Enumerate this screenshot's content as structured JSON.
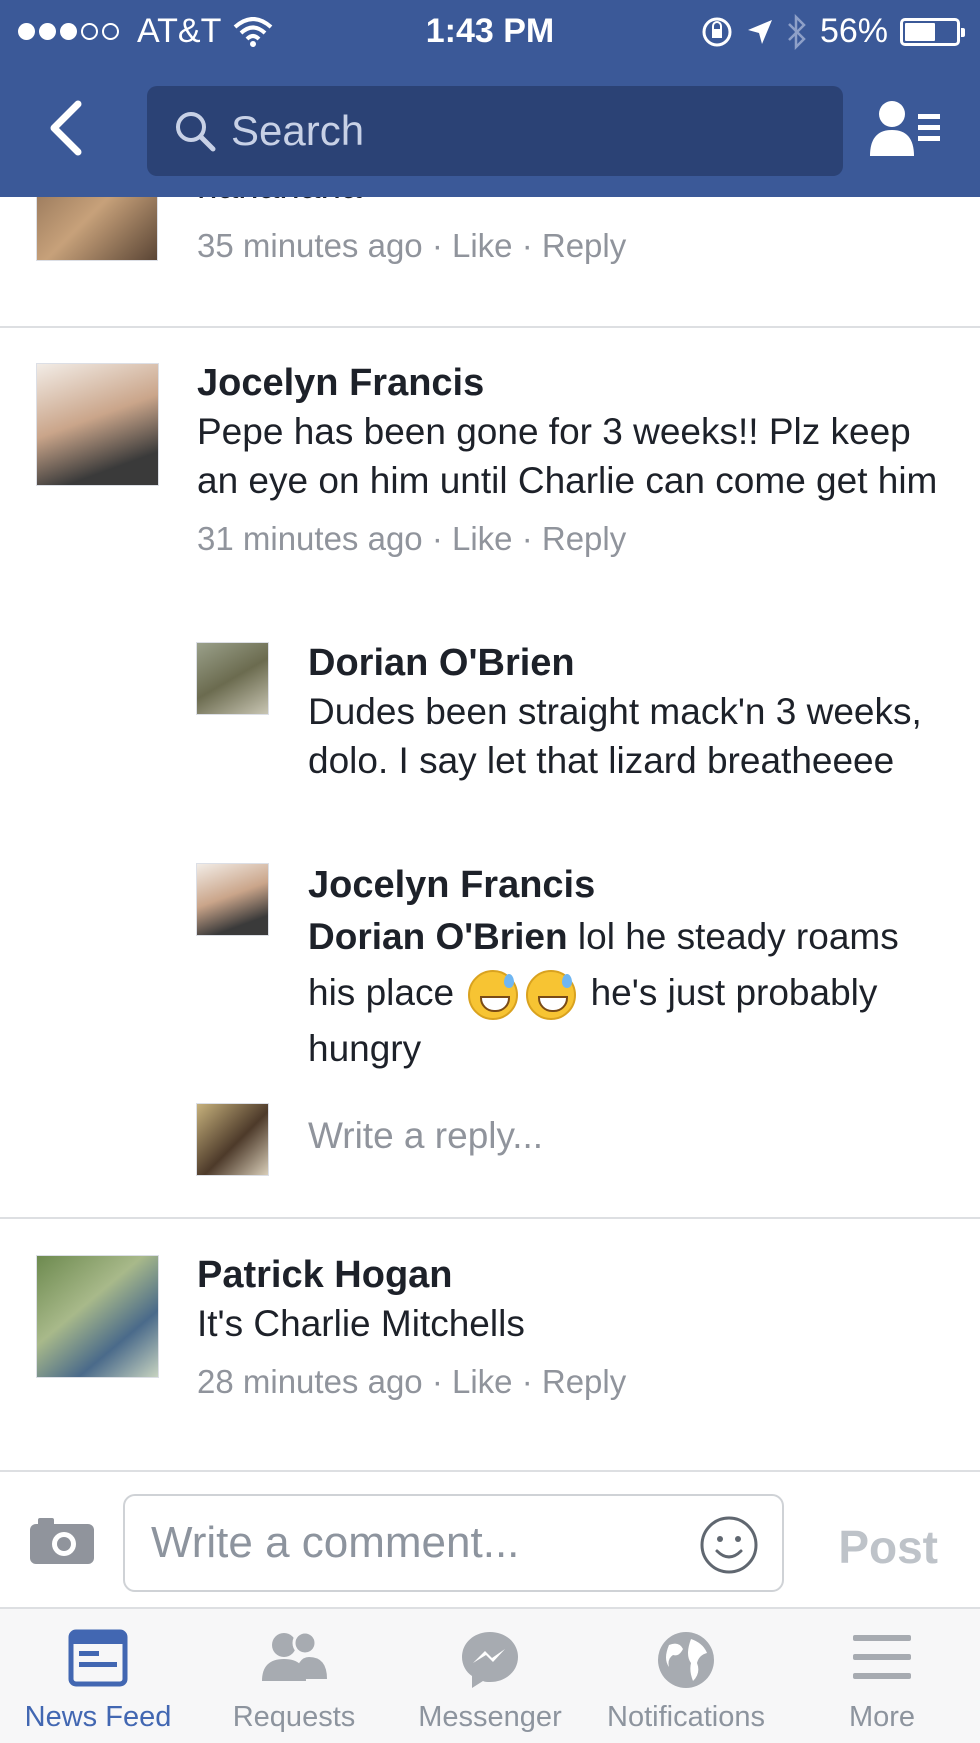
{
  "status_bar": {
    "carrier": "AT&T",
    "time": "1:43 PM",
    "battery": "56%",
    "battery_level": 0.56,
    "signal_bars_filled": 3,
    "signal_bars_total": 5
  },
  "nav": {
    "search_placeholder": "Search"
  },
  "comments": [
    {
      "body": "hahahaha",
      "time": "35 minutes ago",
      "like": "Like",
      "reply": "Reply"
    },
    {
      "name": "Jocelyn Francis",
      "body": "Pepe has been gone for 3 weeks!! Plz keep an eye on him until Charlie can come get him",
      "time": "31 minutes ago",
      "like": "Like",
      "reply": "Reply",
      "replies": [
        {
          "name": "Dorian O'Brien",
          "body": "Dudes been straight mack'n 3 weeks, dolo. I say let that lizard breatheeee"
        },
        {
          "name": "Jocelyn Francis",
          "mention": "Dorian O'Brien",
          "body_part1": "lol he steady roams his place",
          "body_part2": "he's just probably hungry",
          "emoji": "sweat-smile-emoji"
        }
      ],
      "reply_placeholder": "Write a reply..."
    },
    {
      "name": "Patrick Hogan",
      "body": "It's Charlie Mitchells",
      "time": "28 minutes ago",
      "like": "Like",
      "reply": "Reply"
    }
  ],
  "composer": {
    "placeholder": "Write a comment...",
    "post_label": "Post"
  },
  "tabs": [
    {
      "label": "News Feed",
      "icon": "news-feed-icon",
      "active": true
    },
    {
      "label": "Requests",
      "icon": "friend-requests-icon",
      "active": false
    },
    {
      "label": "Messenger",
      "icon": "messenger-icon",
      "active": false
    },
    {
      "label": "Notifications",
      "icon": "globe-icon",
      "active": false
    },
    {
      "label": "More",
      "icon": "menu-icon",
      "active": false
    }
  ],
  "colors": {
    "brand": "#3b5998",
    "search_bg": "#2b4275",
    "meta_text": "#90949c",
    "active_tab": "#4267b2"
  }
}
